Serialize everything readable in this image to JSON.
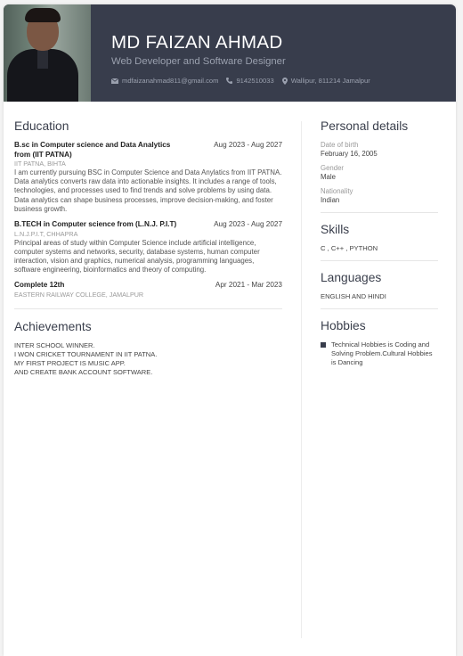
{
  "header": {
    "name": "MD FAIZAN AHMAD",
    "subtitle": "Web Developer and Software Designer",
    "email": "mdfaizanahmad811@gmail.com",
    "phone": "9142510033",
    "address": "Wallipur, 811214 Jamalpur",
    "colors": {
      "header_bg": "#383d4c",
      "name": "#ffffff",
      "muted": "#9aa0ae"
    }
  },
  "education": {
    "title": "Education",
    "entries": [
      {
        "title": "B.sc in Computer science and Data Analytics from (IIT PATNA)",
        "date": "Aug 2023 - Aug 2027",
        "institution": "IIT PATNA, BIHTA",
        "description": "I am currently pursuing BSC in Computer Science and Data Anylatics from IIT PATNA. Data analytics converts raw data into actionable insights. It includes a range of tools, technologies, and processes used to find trends and solve problems by using data. Data analytics can shape business processes, improve decision-making, and foster business growth."
      },
      {
        "title": "B.TECH in Computer science from (L.N.J. P.I.T)",
        "date": "Aug 2023 - Aug 2027",
        "institution": "L.N.J.P.I.T, CHHAPRA",
        "description": "Principal areas of study within Computer Science include artificial intelligence, computer systems and networks, security, database systems, human computer interaction, vision and graphics, numerical analysis, programming languages, software engineering, bioinformatics and theory of computing."
      },
      {
        "title": "Complete 12th",
        "date": "Apr 2021 - Mar 2023",
        "institution": "EASTERN RAILWAY COLLEGE, JAMALPUR",
        "description": ""
      }
    ]
  },
  "achievements": {
    "title": "Achievements",
    "lines": [
      "INTER SCHOOL WINNER.",
      "I WON CRICKET TOURNAMENT IN IIT PATNA.",
      "MY FIRST PROJECT IS MUSIC APP.",
      "AND CREATE BANK ACCOUNT SOFTWARE."
    ]
  },
  "personal": {
    "title": "Personal details",
    "dob_label": "Date of birth",
    "dob_value": "February 16, 2005",
    "gender_label": "Gender",
    "gender_value": "Male",
    "nationality_label": "Nationality",
    "nationality_value": "Indian"
  },
  "skills": {
    "title": "Skills",
    "value": "C , C++ , PYTHON"
  },
  "languages": {
    "title": "Languages",
    "value": "ENGLISH AND HINDI"
  },
  "hobbies": {
    "title": "Hobbies",
    "items": [
      "Technical Hobbies is Coding and Solving Problem.Cultural Hobbies is Dancing"
    ]
  },
  "icons": [
    "envelope-icon",
    "phone-icon",
    "location-pin-icon"
  ]
}
